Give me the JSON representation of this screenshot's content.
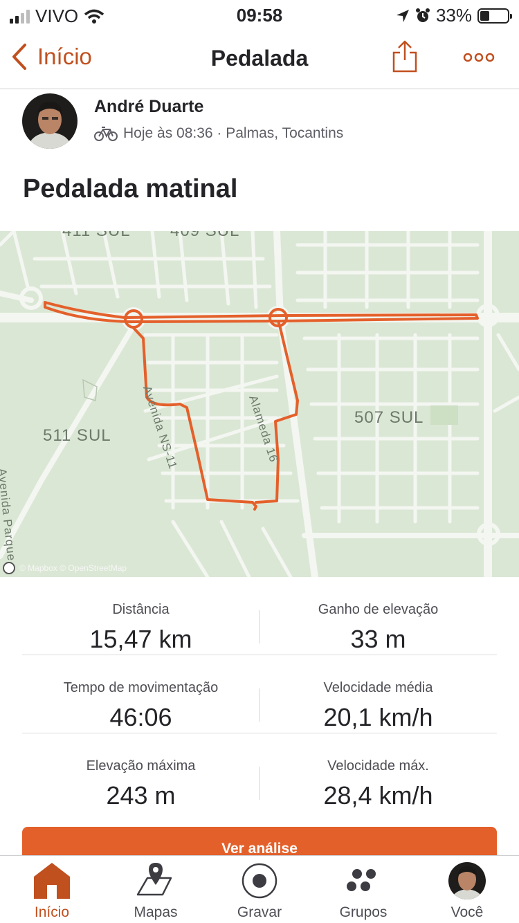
{
  "status_bar": {
    "carrier": "VIVO",
    "time": "09:58",
    "battery_percent": "33%",
    "battery_level": 0.33
  },
  "nav": {
    "back_label": "Início",
    "title": "Pedalada"
  },
  "activity": {
    "athlete_name": "André Duarte",
    "meta": "Hoje às 08:36 · Palmas, Tocantins",
    "title": "Pedalada matinal"
  },
  "map": {
    "labels": [
      "411 SUL",
      "409 SUL",
      "511 SUL",
      "507 SUL",
      "Avenida NS-11",
      "Alameda 16",
      "Avenida Parque"
    ],
    "attribution": "© Mapbox © OpenStreetMap",
    "route_color": "#e4602b"
  },
  "stats": [
    {
      "left": {
        "label": "Distância",
        "value": "15,47 km"
      },
      "right": {
        "label": "Ganho de elevação",
        "value": "33 m"
      }
    },
    {
      "left": {
        "label": "Tempo de movimentação",
        "value": "46:06"
      },
      "right": {
        "label": "Velocidade média",
        "value": "20,1 km/h"
      }
    },
    {
      "left": {
        "label": "Elevação máxima",
        "value": "243 m"
      },
      "right": {
        "label": "Velocidade máx.",
        "value": "28,4 km/h"
      }
    }
  ],
  "analysis_button": "Ver análise",
  "tabs": [
    {
      "label": "Início",
      "icon": "home-icon"
    },
    {
      "label": "Mapas",
      "icon": "map-icon"
    },
    {
      "label": "Gravar",
      "icon": "record-icon"
    },
    {
      "label": "Grupos",
      "icon": "groups-icon"
    },
    {
      "label": "Você",
      "icon": "profile-icon"
    }
  ],
  "colors": {
    "accent": "#e4602b",
    "accent_text": "#c1501f",
    "map_background": "#dbe7d5"
  }
}
